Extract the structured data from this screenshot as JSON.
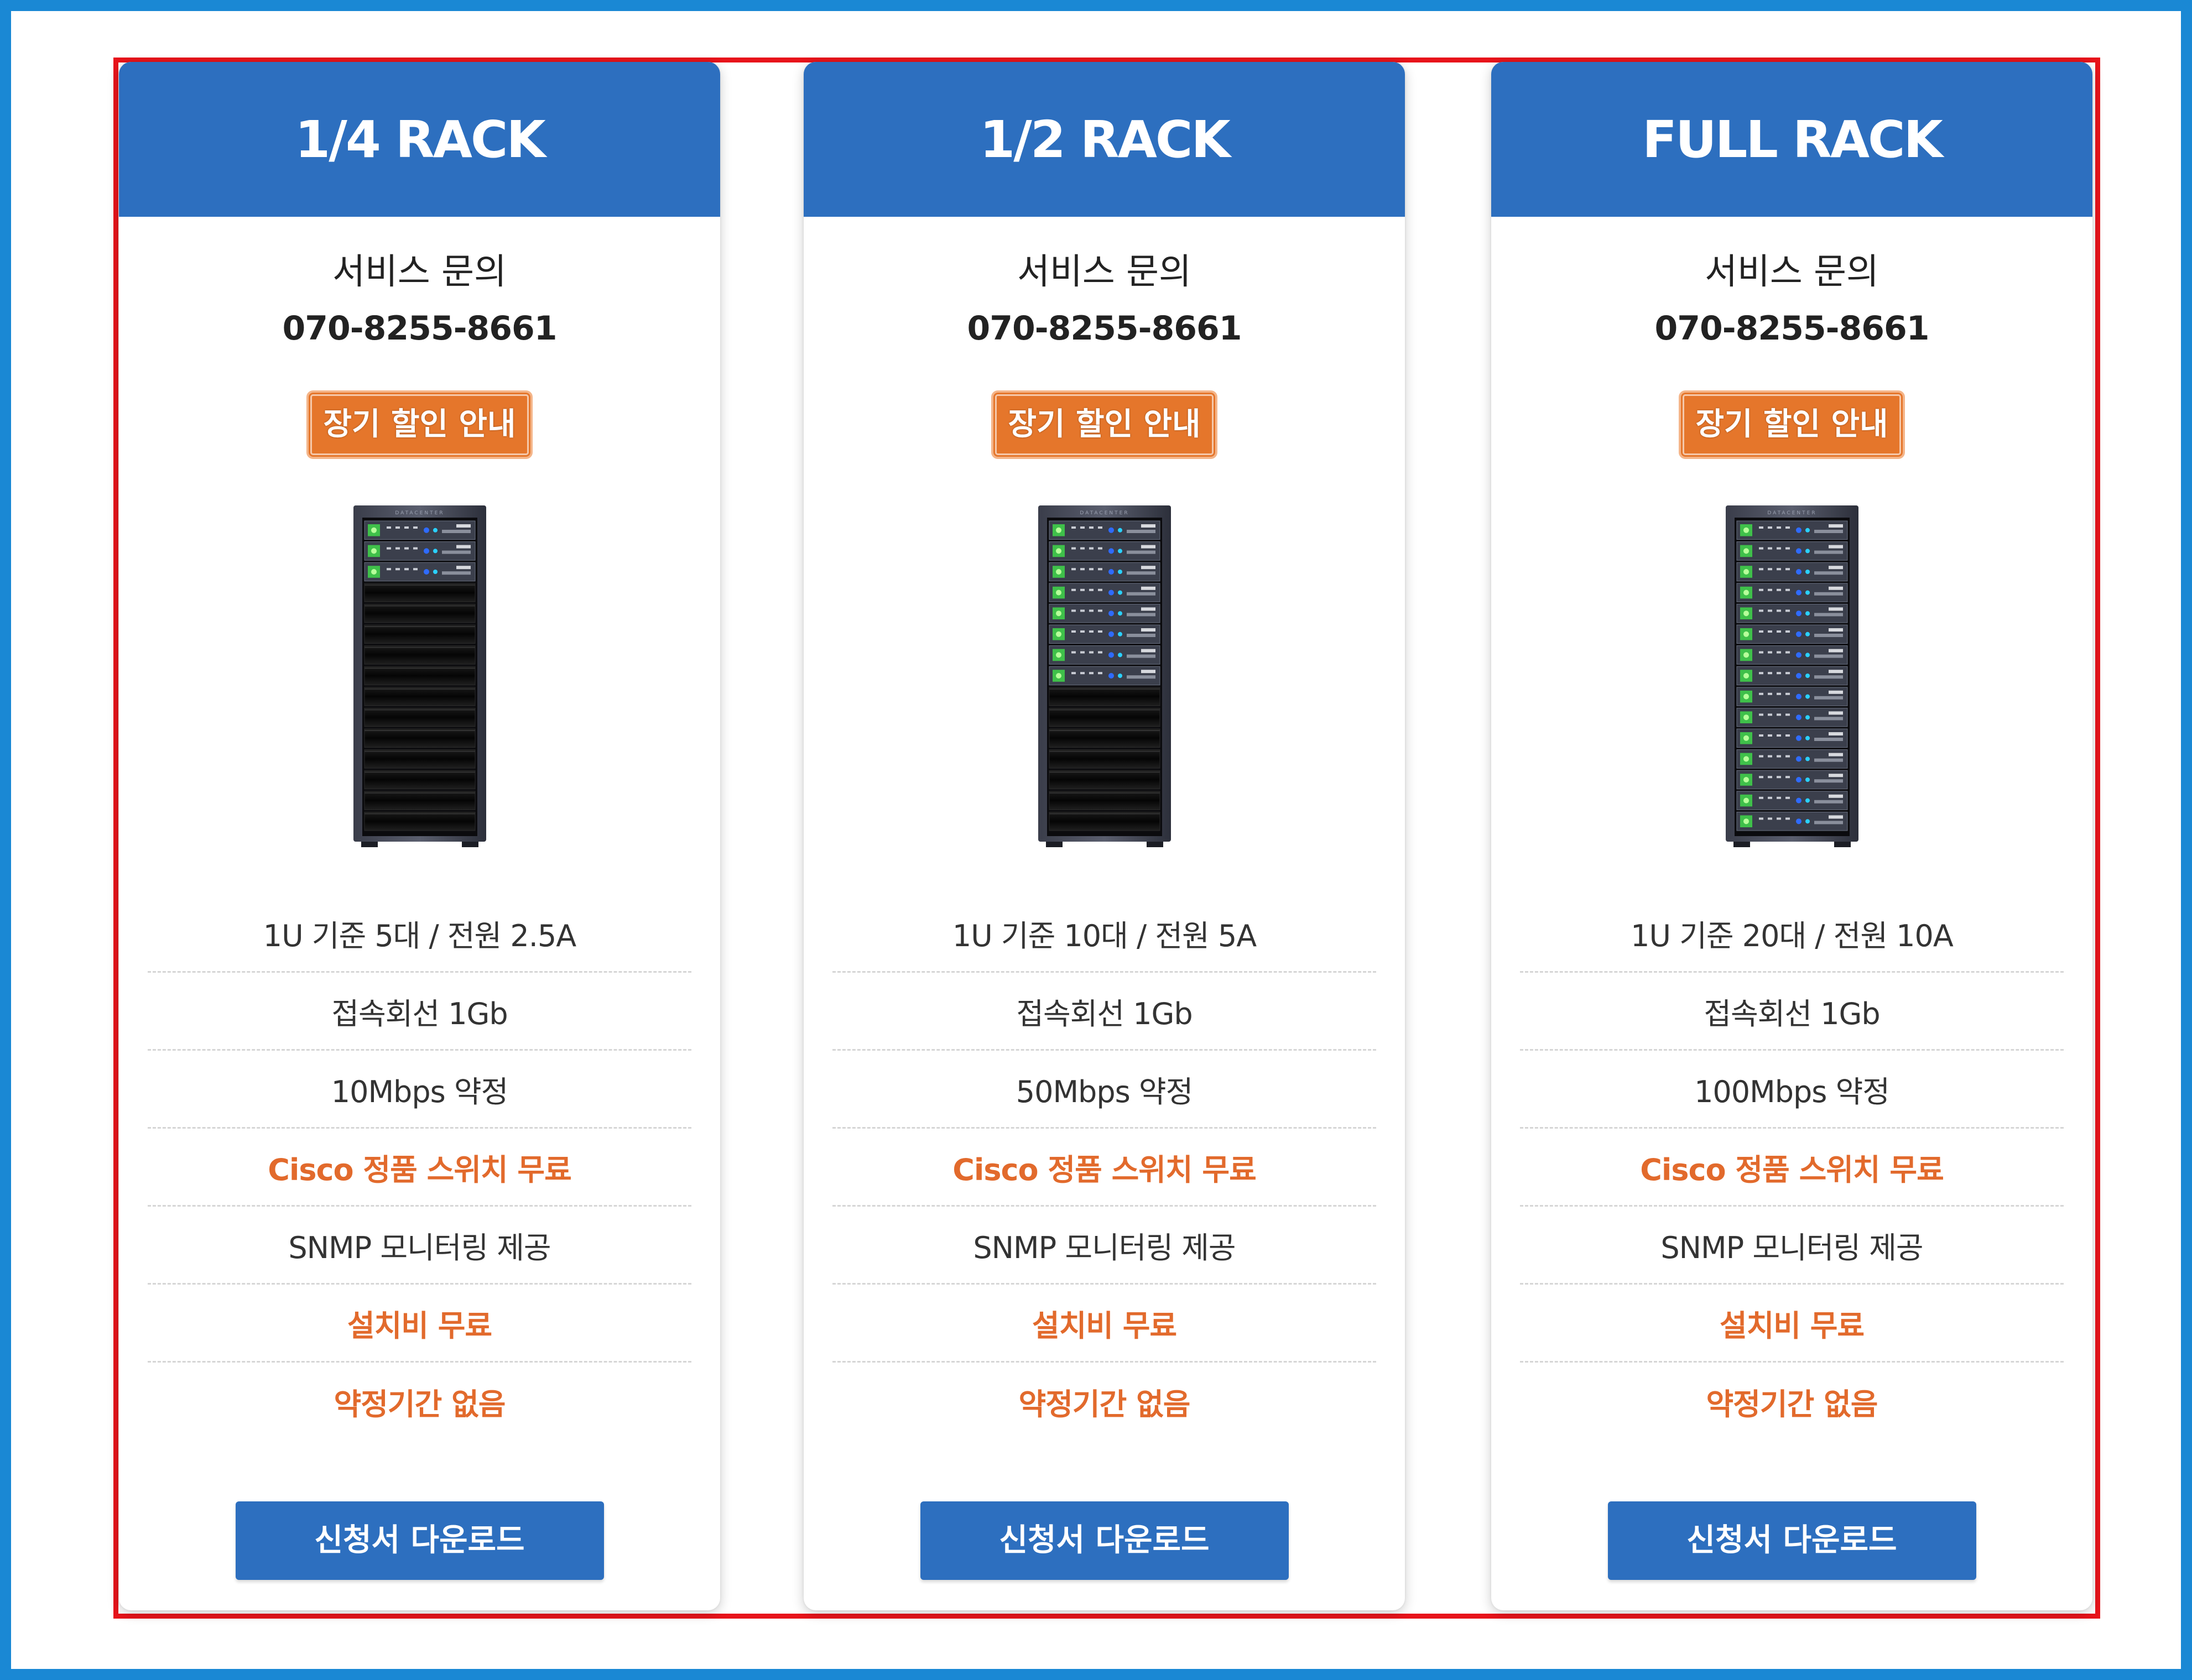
{
  "plans": [
    {
      "title": "1/4 RACK",
      "inquiry_title": "서비스 문의",
      "inquiry_phone": "070-8255-8661",
      "discount_label": "장기 할인 안내",
      "rack_filled_units": 3,
      "features": [
        {
          "text": "1U 기준 5대 / 전원 2.5A",
          "accent": false
        },
        {
          "text": "접속회선 1Gb",
          "accent": false
        },
        {
          "text": "10Mbps 약정",
          "accent": false
        },
        {
          "text": "Cisco 정품 스위치 무료",
          "accent": true
        },
        {
          "text": "SNMP 모니터링 제공",
          "accent": false
        },
        {
          "text": "설치비 무료",
          "accent": true
        },
        {
          "text": "약정기간 없음",
          "accent": true
        }
      ],
      "download_label": "신청서 다운로드"
    },
    {
      "title": "1/2 RACK",
      "inquiry_title": "서비스 문의",
      "inquiry_phone": "070-8255-8661",
      "discount_label": "장기 할인 안내",
      "rack_filled_units": 8,
      "features": [
        {
          "text": "1U 기준 10대 / 전원 5A",
          "accent": false
        },
        {
          "text": "접속회선 1Gb",
          "accent": false
        },
        {
          "text": "50Mbps 약정",
          "accent": false
        },
        {
          "text": "Cisco 정품 스위치 무료",
          "accent": true
        },
        {
          "text": "SNMP 모니터링 제공",
          "accent": false
        },
        {
          "text": "설치비 무료",
          "accent": true
        },
        {
          "text": "약정기간 없음",
          "accent": true
        }
      ],
      "download_label": "신청서 다운로드"
    },
    {
      "title": "FULL RACK",
      "inquiry_title": "서비스 문의",
      "inquiry_phone": "070-8255-8661",
      "discount_label": "장기 할인 안내",
      "rack_filled_units": 15,
      "features": [
        {
          "text": "1U 기준 20대 / 전원 10A",
          "accent": false
        },
        {
          "text": "접속회선 1Gb",
          "accent": false
        },
        {
          "text": "100Mbps 약정",
          "accent": false
        },
        {
          "text": "Cisco 정품 스위치 무료",
          "accent": true
        },
        {
          "text": "SNMP 모니터링 제공",
          "accent": false
        },
        {
          "text": "설치비 무료",
          "accent": true
        },
        {
          "text": "약정기간 없음",
          "accent": true
        }
      ],
      "download_label": "신청서 다운로드"
    }
  ],
  "rack_total_units": 15,
  "rack_brand": "DATACENTER",
  "colors": {
    "header_blue": "#2d6fbf",
    "accent_orange": "#e26a2c",
    "button_orange": "#e5762b",
    "outer_border": "#1a88d4",
    "highlight_border": "#e8141b"
  }
}
